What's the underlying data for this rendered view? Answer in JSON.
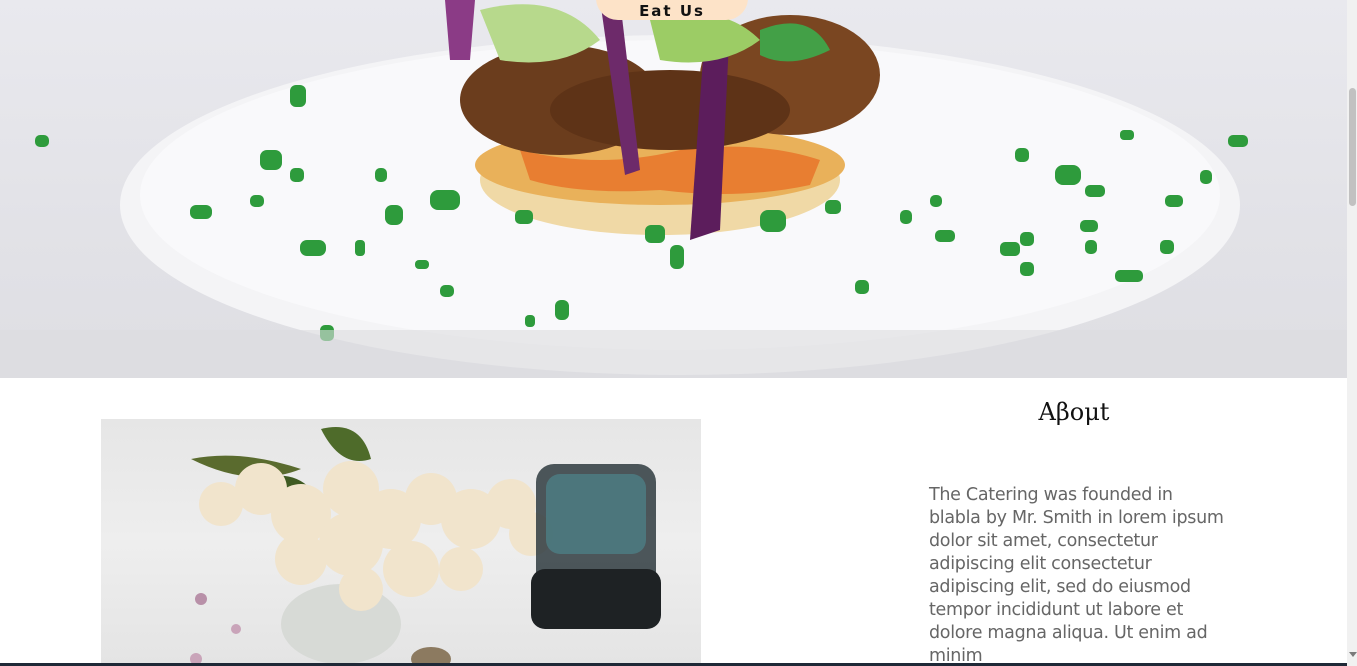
{
  "hero": {
    "button_label": "Eat Us",
    "image_icon": "food-photo-hero"
  },
  "about": {
    "title": "Aβoμt",
    "text": "The Catering was founded in blabla by Mr. Smith in lorem ipsum dolor sit amet, consectetur adipiscing elit consectetur adipiscing elit, sed do eiusmod tempor incididunt ut labore et dolore magna aliqua. Ut enim ad minim",
    "image_icon": "flowers-photo"
  },
  "colors": {
    "button_bg": "#fde3c8",
    "heading": "#111111",
    "body_text": "#666666",
    "scrollbar_thumb": "#c1c1c1"
  }
}
